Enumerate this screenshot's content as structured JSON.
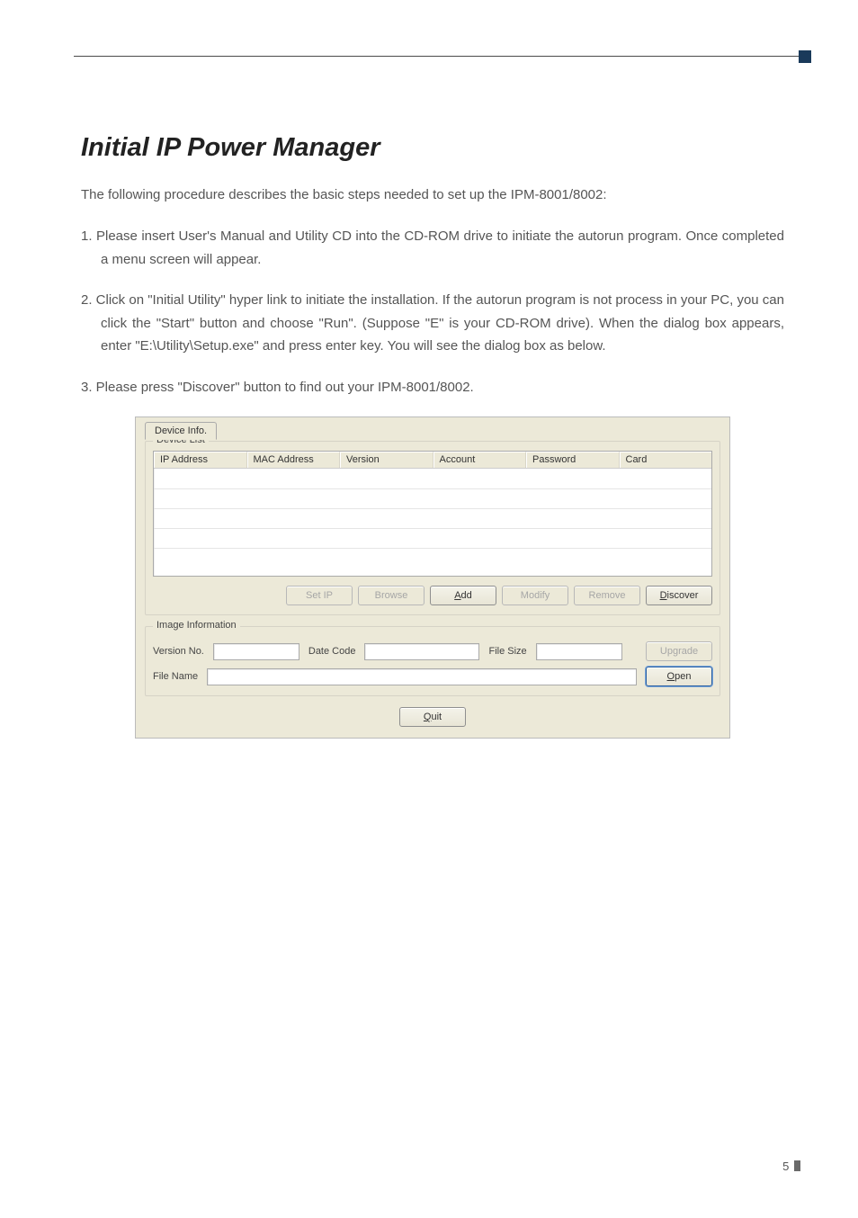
{
  "heading": "Initial IP Power Manager",
  "intro": "The following procedure describes the basic steps needed to set up the IPM-8001/8002:",
  "steps": {
    "s1": "1. Please insert User's Manual and Utility CD into the CD-ROM drive to initiate the autorun program. Once completed a menu screen will appear.",
    "s2": "2. Click on \"Initial Utility\" hyper link to initiate the installation. If the autorun program is not process in your PC, you can click the \"Start\" button and choose \"Run\". (Suppose \"E\" is your CD-ROM drive). When the dialog box appears, enter \"E:\\Utility\\Setup.exe\" and press enter key. You will see the dialog box as below.",
    "s3": "3. Please press \"Discover\" button to find out your IPM-8001/8002."
  },
  "dialog": {
    "tab": "Device Info.",
    "group_device_list": "Device List",
    "columns": {
      "ip": "IP Address",
      "mac": "MAC Address",
      "version": "Version",
      "account": "Account",
      "password": "Password",
      "card": "Card"
    },
    "buttons": {
      "setip": "Set IP",
      "browse": "Browse",
      "add": "Add",
      "modify": "Modify",
      "remove": "Remove",
      "discover": "Discover",
      "upgrade": "Upgrade",
      "open": "Open",
      "quit": "Quit"
    },
    "group_image_info": "Image Information",
    "labels": {
      "version_no": "Version No.",
      "date_code": "Date Code",
      "file_size": "File Size",
      "file_name": "File Name"
    }
  },
  "page_number": "5"
}
